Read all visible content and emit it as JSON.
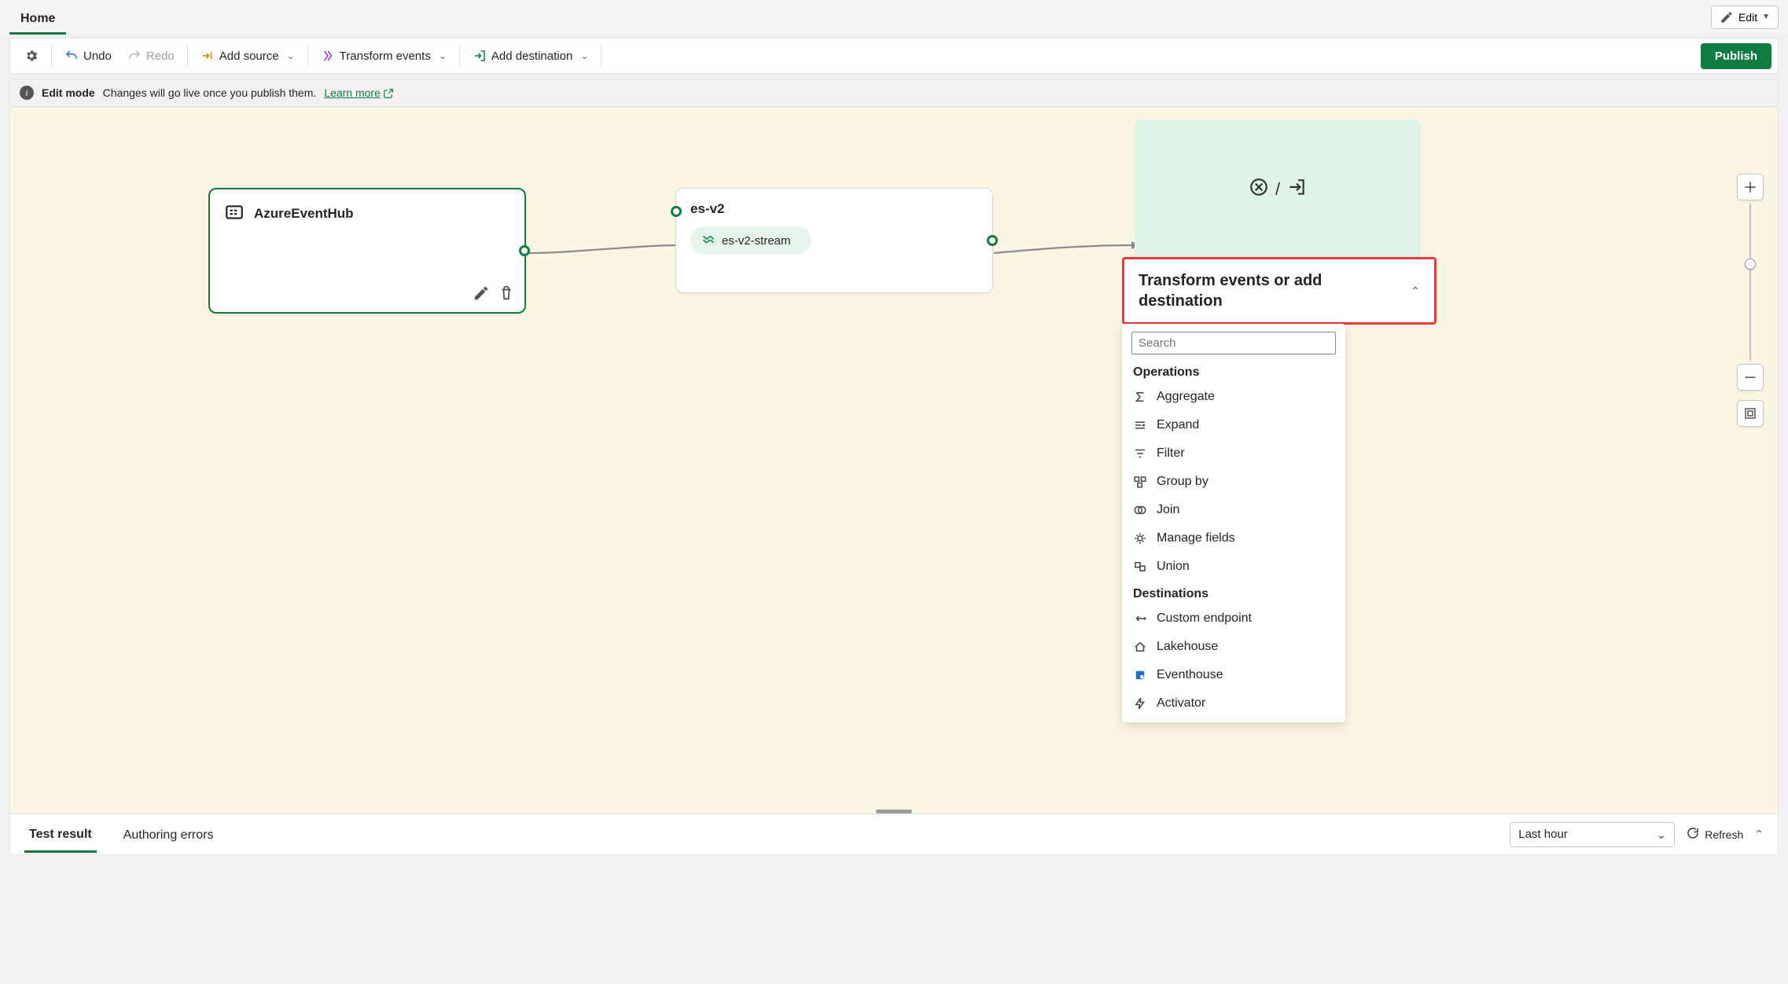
{
  "header": {
    "home_tab": "Home",
    "edit_label": "Edit"
  },
  "toolbar": {
    "undo": "Undo",
    "redo": "Redo",
    "add_source": "Add source",
    "transform_events": "Transform events",
    "add_destination": "Add destination",
    "publish": "Publish"
  },
  "infobar": {
    "mode": "Edit mode",
    "msg": "Changes will go live once you publish them.",
    "learn": "Learn more"
  },
  "nodes": {
    "n1": {
      "title": "AzureEventHub"
    },
    "n2": {
      "title": "es-v2",
      "stream": "es-v2-stream"
    }
  },
  "dropdown": {
    "title": "Transform events or add destination",
    "search_placeholder": "Search",
    "section_ops": "Operations",
    "section_dest": "Destinations",
    "ops": [
      {
        "icon": "sigma",
        "label": "Aggregate"
      },
      {
        "icon": "expand",
        "label": "Expand"
      },
      {
        "icon": "filter",
        "label": "Filter"
      },
      {
        "icon": "groupby",
        "label": "Group by"
      },
      {
        "icon": "join",
        "label": "Join"
      },
      {
        "icon": "manage",
        "label": "Manage fields"
      },
      {
        "icon": "union",
        "label": "Union"
      }
    ],
    "dests": [
      {
        "icon": "endpoint",
        "label": "Custom endpoint"
      },
      {
        "icon": "lakehouse",
        "label": "Lakehouse"
      },
      {
        "icon": "eventhouse",
        "label": "Eventhouse"
      },
      {
        "icon": "activator",
        "label": "Activator"
      }
    ]
  },
  "bottom": {
    "tab_test": "Test result",
    "tab_err": "Authoring errors",
    "time_range": "Last hour",
    "refresh": "Refresh"
  }
}
